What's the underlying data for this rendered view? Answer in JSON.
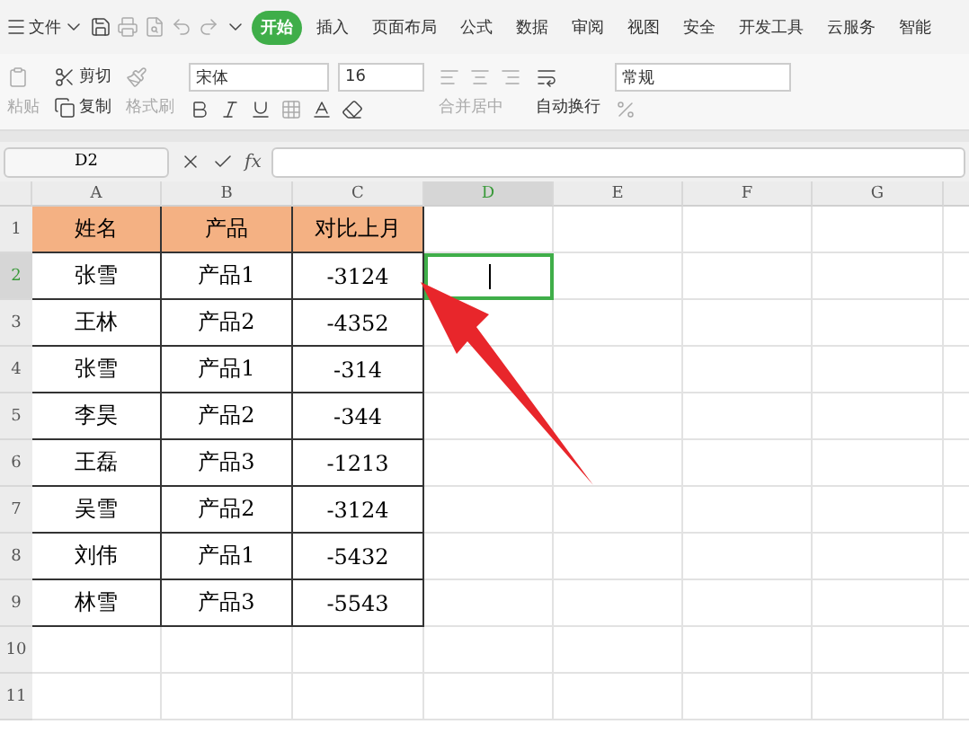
{
  "menu": {
    "file": "文件",
    "tabs": [
      {
        "label": "开始",
        "selected": true
      },
      {
        "label": "插入",
        "selected": false
      },
      {
        "label": "页面布局",
        "selected": false
      },
      {
        "label": "公式",
        "selected": false
      },
      {
        "label": "数据",
        "selected": false
      },
      {
        "label": "审阅",
        "selected": false
      },
      {
        "label": "视图",
        "selected": false
      },
      {
        "label": "安全",
        "selected": false
      },
      {
        "label": "开发工具",
        "selected": false
      },
      {
        "label": "云服务",
        "selected": false
      },
      {
        "label": "智能",
        "selected": false
      }
    ]
  },
  "ribbon": {
    "paste": "粘贴",
    "cut": "剪切",
    "copy": "复制",
    "format_painter": "格式刷",
    "font": "宋体",
    "size": "16",
    "merge": "合并居中",
    "wrap": "自动换行",
    "number_format": "常规"
  },
  "formula_bar": {
    "name_box": "D2",
    "fx": "fx"
  },
  "sheet": {
    "columns": [
      {
        "label": "A",
        "selected": false
      },
      {
        "label": "B",
        "selected": false
      },
      {
        "label": "C",
        "selected": false
      },
      {
        "label": "D",
        "selected": true
      },
      {
        "label": "E",
        "selected": false
      },
      {
        "label": "F",
        "selected": false
      },
      {
        "label": "G",
        "selected": false
      }
    ],
    "rows": [
      {
        "number": "1",
        "selected": false,
        "cells": [
          "姓名",
          "产品",
          "对比上月"
        ]
      },
      {
        "number": "2",
        "selected": true,
        "cells": [
          "张雪",
          "产品1",
          "-3124"
        ]
      },
      {
        "number": "3",
        "selected": false,
        "cells": [
          "王林",
          "产品2",
          "-4352"
        ]
      },
      {
        "number": "4",
        "selected": false,
        "cells": [
          "张雪",
          "产品1",
          "-314"
        ]
      },
      {
        "number": "5",
        "selected": false,
        "cells": [
          "李昊",
          "产品2",
          "-344"
        ]
      },
      {
        "number": "6",
        "selected": false,
        "cells": [
          "王磊",
          "产品3",
          "-1213"
        ]
      },
      {
        "number": "7",
        "selected": false,
        "cells": [
          "吴雪",
          "产品2",
          "-3124"
        ]
      },
      {
        "number": "8",
        "selected": false,
        "cells": [
          "刘伟",
          "产品1",
          "-5432"
        ]
      },
      {
        "number": "9",
        "selected": false,
        "cells": [
          "林雪",
          "产品3",
          "-5543"
        ]
      },
      {
        "number": "10",
        "selected": false,
        "cells": []
      },
      {
        "number": "11",
        "selected": false,
        "cells": []
      }
    ]
  }
}
